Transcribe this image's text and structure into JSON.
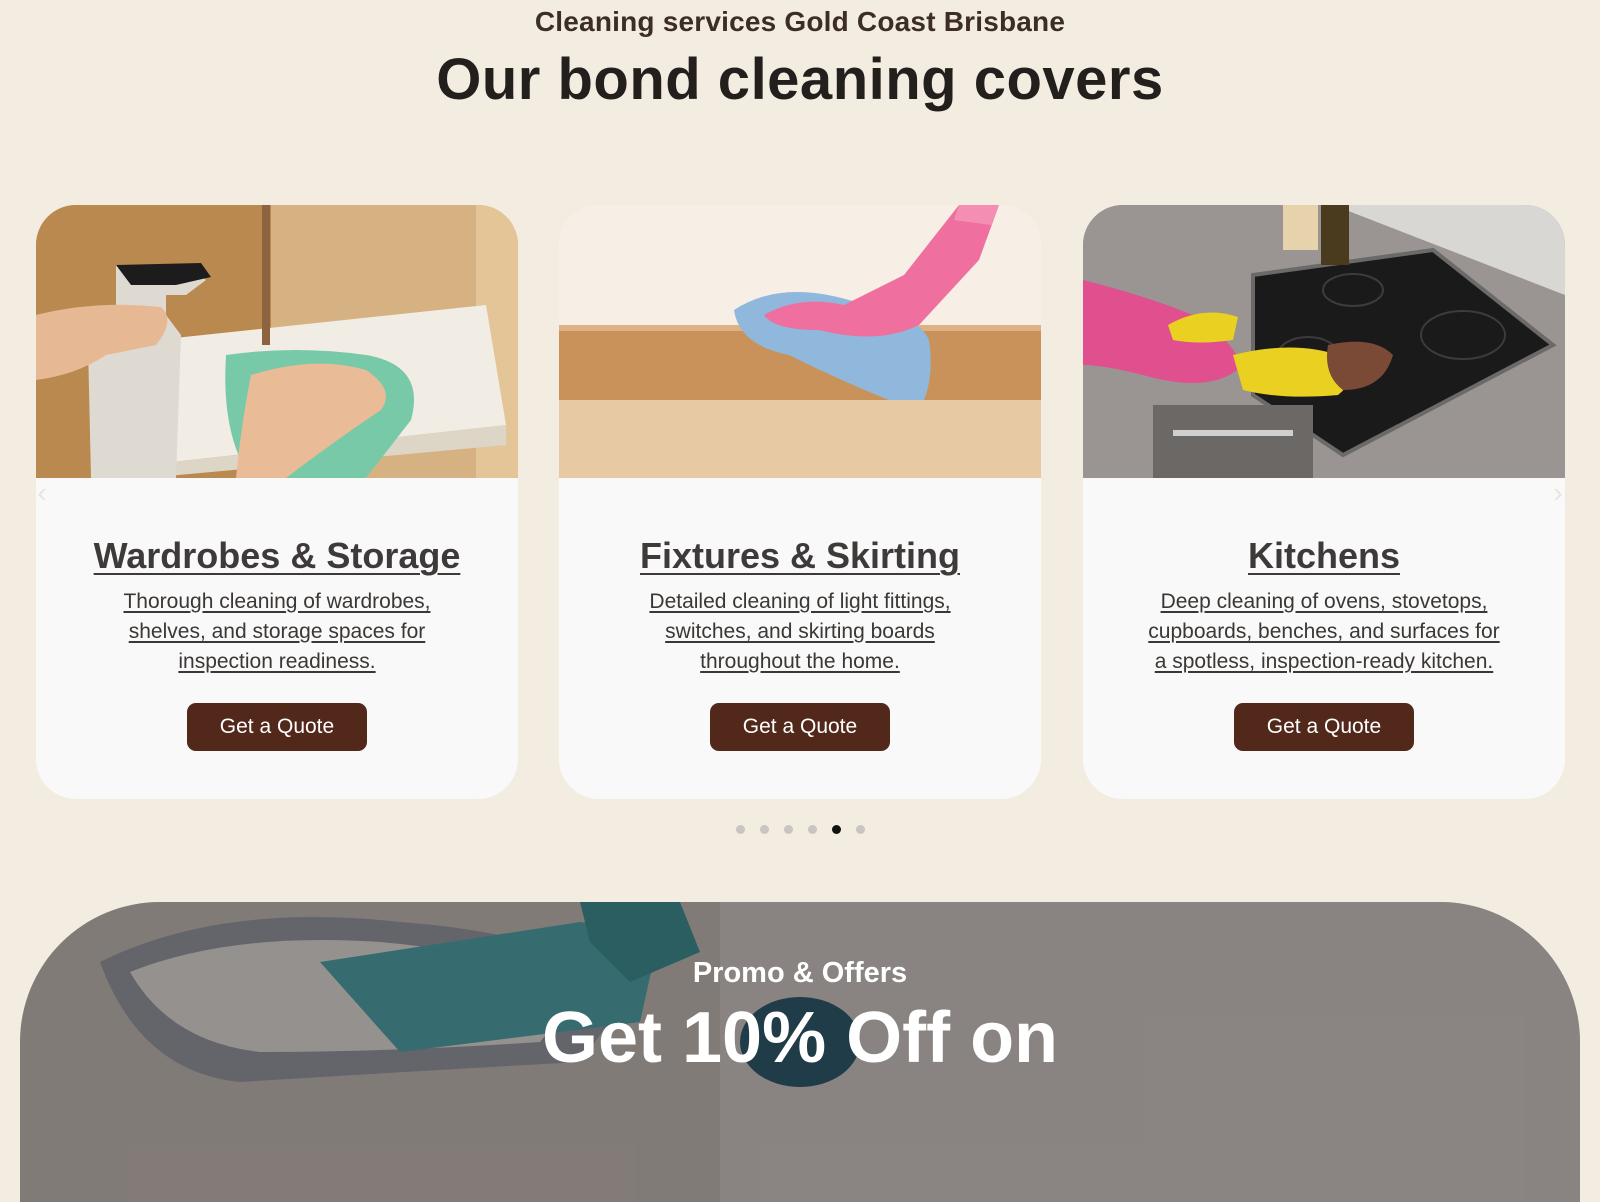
{
  "header": {
    "eyebrow": "Cleaning services Gold Coast Brisbane",
    "title": "Our bond cleaning covers"
  },
  "carousel": {
    "cards": [
      {
        "title": "Wardrobes & Storage",
        "description": "Thorough cleaning of wardrobes, shelves, and storage spaces for inspection readiness.",
        "button": "Get a Quote"
      },
      {
        "title": "Fixtures & Skirting",
        "description": "Detailed cleaning of light fittings, switches, and skirting boards throughout the home.",
        "button": "Get a Quote"
      },
      {
        "title": "Kitchens",
        "description": "Deep cleaning of ovens, stovetops, cupboards, benches, and surfaces for a spotless, inspection-ready kitchen.",
        "button": "Get a Quote"
      }
    ],
    "arrows": {
      "prev": "‹",
      "next": "›"
    },
    "page_count": 6,
    "active_page": 5
  },
  "promo": {
    "eyebrow": "Promo & Offers",
    "headline": "Get 10% Off on"
  },
  "colors": {
    "page_background": "#f3ece0",
    "card_background": "#f8f9f8",
    "button_background": "#52281a",
    "button_text": "#ffffff",
    "active_dot": "#111111",
    "inactive_dot": "#c9c5c0"
  }
}
